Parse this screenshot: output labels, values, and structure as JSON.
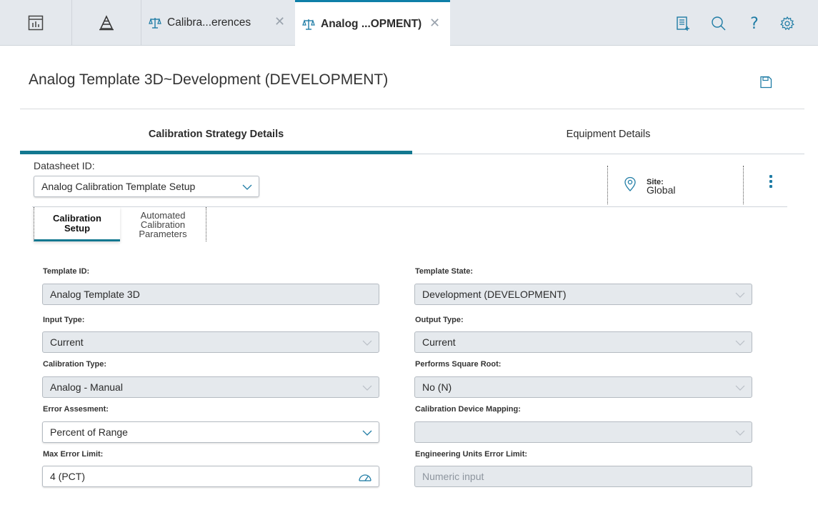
{
  "tabs": [
    {
      "label": "Calibra...erences"
    },
    {
      "label": "Analog ...OPMENT)"
    }
  ],
  "page": {
    "title": "Analog Template 3D~Development (DEVELOPMENT)"
  },
  "main_tabs": [
    {
      "label": "Calibration Strategy Details"
    },
    {
      "label": "Equipment Details"
    }
  ],
  "datasheet": {
    "label": "Datasheet ID:",
    "value": "Analog Calibration Template Setup"
  },
  "site": {
    "label": "Site:",
    "value": "Global"
  },
  "sub_tabs": [
    {
      "line1": "Calibration",
      "line2": "Setup",
      "line3": ""
    },
    {
      "line1": "Automated",
      "line2": "Calibration",
      "line3": "Parameters"
    }
  ],
  "form": {
    "template_id": {
      "label": "Template ID:",
      "value": "Analog Template 3D"
    },
    "template_state": {
      "label": "Template State:",
      "value": "Development (DEVELOPMENT)"
    },
    "input_type": {
      "label": "Input Type:",
      "value": "Current"
    },
    "output_type": {
      "label": "Output Type:",
      "value": "Current"
    },
    "calibration_type": {
      "label": "Calibration Type:",
      "value": "Analog - Manual"
    },
    "performs_square_root": {
      "label": "Performs Square Root:",
      "value": "No (N)"
    },
    "error_assesment": {
      "label": "Error Assesment:",
      "value": "Percent of Range"
    },
    "calibration_device_mapping": {
      "label": "Calibration Device Mapping:",
      "value": ""
    },
    "max_error_limit": {
      "label": "Max Error Limit:",
      "value": "4 (PCT)"
    },
    "eng_units_error_limit": {
      "label": "Engineering Units Error Limit:",
      "placeholder": "Numeric input"
    }
  },
  "colors": {
    "accent": "#137890",
    "icon_blue": "#1f7ca5",
    "tab_bar": "#e4e8ed",
    "readonly_field": "#e5e9ed"
  },
  "icons": [
    "dashboard-icon",
    "pyramid-icon",
    "scale-icon",
    "scale-icon",
    "close-icon",
    "report-icon",
    "search-icon",
    "help-icon",
    "gear-icon",
    "save-icon",
    "chevron-down-icon",
    "location-pin-icon",
    "kebab-menu-icon",
    "gauge-icon"
  ]
}
